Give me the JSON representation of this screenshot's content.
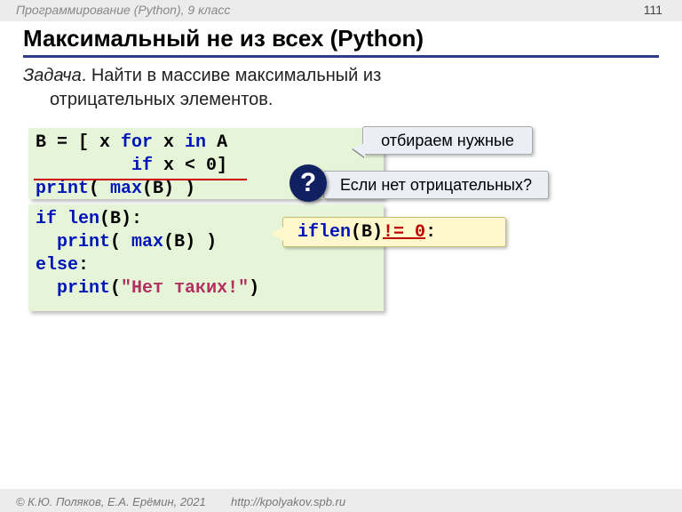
{
  "header": {
    "course": "Программирование (Python), 9 класс",
    "page_number": "111"
  },
  "title": "Максимальный не из всех (Python)",
  "task": {
    "label": "Задача",
    "text_line1": ". Найти в массиве максимальный из",
    "text_line2": "отрицательных элементов."
  },
  "code1": {
    "l1a": "B = [ x ",
    "l1b": "for",
    "l1c": " x ",
    "l1d": "in",
    "l1e": " A",
    "l2a": "         ",
    "l2b": "if",
    "l2c": " x < 0]",
    "l3a": "print",
    "l3b": "( ",
    "l3c": "max",
    "l3d": "(B) )"
  },
  "code2": {
    "l1a": "if",
    "l1b": " ",
    "l1c": "len",
    "l1d": "(B):",
    "l2a": "  ",
    "l2b": "print",
    "l2c": "( ",
    "l2d": "max",
    "l2e": "(B) )",
    "l3a": "else",
    "l3b": ":",
    "l4a": "  ",
    "l4b": "print",
    "l4c": "(",
    "l4d": "\"Нет таких!\"",
    "l4e": ")"
  },
  "callouts": {
    "c1": "отбираем нужные",
    "c2": "Если нет отрицательных?",
    "qmark": "?",
    "c3_if": "if",
    "c3_sp": " ",
    "c3_len": "len",
    "c3_rest": "(B)",
    "c3_red": "!= 0",
    "c3_colon": ":"
  },
  "footer": {
    "copyright": "© К.Ю. Поляков, Е.А. Ерёмин, 2021",
    "url": "http://kpolyakov.spb.ru"
  }
}
